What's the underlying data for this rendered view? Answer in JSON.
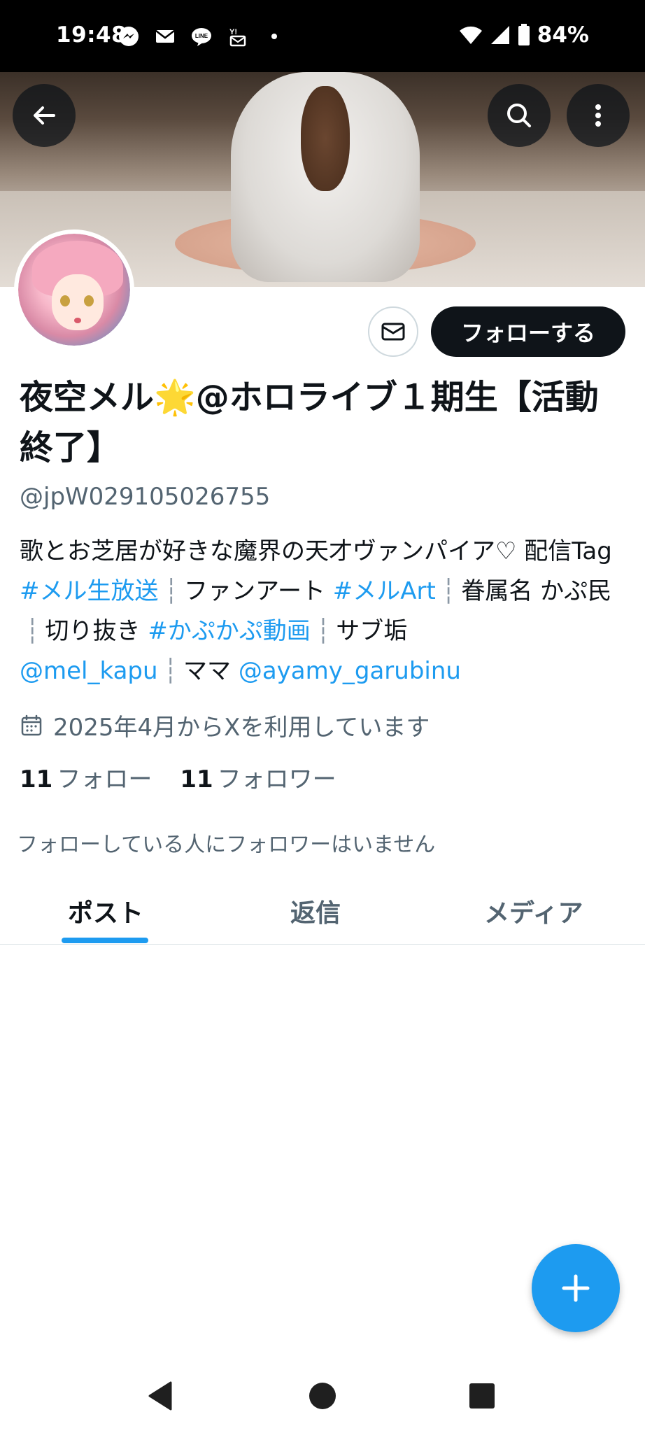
{
  "status_bar": {
    "time": "19:48",
    "notification_icons": [
      "messenger-icon",
      "mail-icon",
      "line-icon",
      "yahoo-mail-icon",
      "dot-icon"
    ],
    "battery_percent": "84%"
  },
  "header": {
    "back_icon": "arrow-left-icon",
    "search_icon": "search-icon",
    "more_icon": "more-vertical-icon"
  },
  "profile": {
    "display_name": "夜空メル🌟@ホロライブ１期生【活動終了】",
    "handle": "@jpW029105026755",
    "bio": {
      "t1": "歌とお芝居が好きな魔界の天才ヴァンパイア♡ 配信Tag ",
      "l1": "#メル生放送",
      "sep": "┆",
      "t2": "ファンアート ",
      "l2": "#メルArt",
      "t3": "眷属名 かぷ民",
      "t4": "切り抜き ",
      "l3": "#かぷかぷ動画",
      "t5": "サブ垢",
      "l4": "@mel_kapu",
      "t6": "ママ ",
      "l5": "@ayamy_garubinu"
    },
    "joined": "2025年4月からXを利用しています",
    "following_count": "11",
    "following_label": "フォロー",
    "followers_count": "11",
    "followers_label": "フォロワー",
    "no_mutual_followers": "フォローしている人にフォロワーはいません",
    "follow_button": "フォローする"
  },
  "tabs": [
    {
      "label": "ポスト",
      "active": true
    },
    {
      "label": "返信",
      "active": false
    },
    {
      "label": "メディア",
      "active": false
    }
  ],
  "colors": {
    "accent": "#1d9bf0",
    "text_primary": "#0f1419",
    "text_secondary": "#536471"
  }
}
